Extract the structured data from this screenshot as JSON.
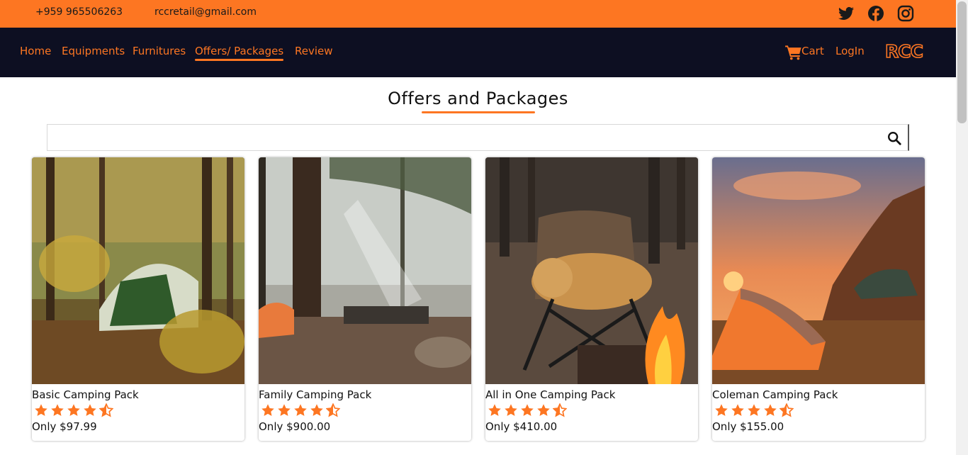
{
  "topbar": {
    "phone": "+959 965506263",
    "email": "rccretail@gmail.com",
    "social_icons": [
      "twitter-icon",
      "facebook-icon",
      "instagram-icon"
    ]
  },
  "nav": {
    "links": [
      "Home",
      "Equipments",
      "Furnitures",
      "Offers/ Packages",
      "Review"
    ],
    "active": "Offers/ Packages",
    "cart_label": "Cart",
    "login_label": "LogIn",
    "logo_text": "RCC"
  },
  "page": {
    "title": "Offers and Packages"
  },
  "search": {
    "value": "",
    "placeholder": "",
    "icon": "search-icon"
  },
  "products": [
    {
      "name": "Basic Camping Pack",
      "price": "Only $97.99",
      "rating": 4.5
    },
    {
      "name": "Family Camping Pack",
      "price": "Only $900.00",
      "rating": 4.5
    },
    {
      "name": "All in One Camping Pack",
      "price": "Only $410.00",
      "rating": 4.5
    },
    {
      "name": "Coleman Camping Pack",
      "price": "Only $155.00",
      "rating": 4.5
    }
  ],
  "colors": {
    "accent": "#fd7622",
    "nav_bg": "#0d0f22",
    "page_bg": "#ffffff"
  }
}
